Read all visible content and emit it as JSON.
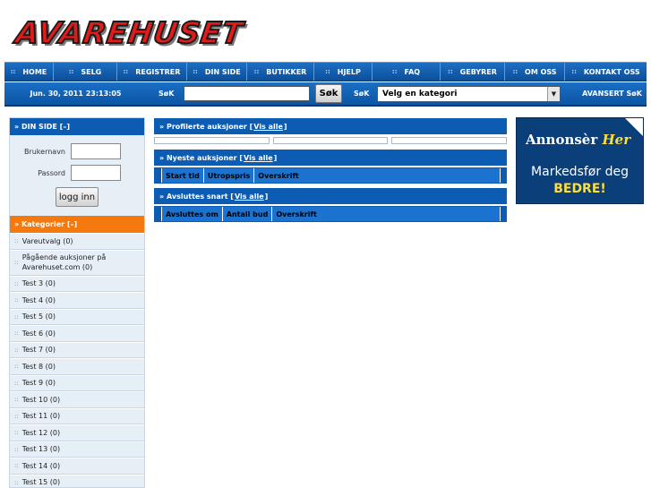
{
  "logo": {
    "text": "Avarehuset"
  },
  "nav": {
    "bullet": "::",
    "items": [
      "HOME",
      "SELG",
      "REGISTRER",
      "DIN SIDE",
      "BUTIKKER",
      "HJELP",
      "FAQ",
      "GEBYRER",
      "OM OSS",
      "KONTAKT OSS"
    ]
  },
  "subbar": {
    "date": "Jun. 30, 2011 23:13:05",
    "search_label": "SøK",
    "search_button": "Søk",
    "search_label2": "SøK",
    "category_select": "Velg en kategori",
    "advanced": "AVANSERT SøK"
  },
  "sidebar": {
    "din_side_header": "» DIN SIDE [–]",
    "username_label": "Brukernavn",
    "password_label": "Passord",
    "login_button": "logg inn",
    "categories_header": "» Kategorier [–]",
    "categories": [
      "Vareutvalg (0)",
      "Pågående auksjoner på Avarehuset.com (0)",
      "Test 3 (0)",
      "Test 4 (0)",
      "Test 5 (0)",
      "Test 6 (0)",
      "Test 7 (0)",
      "Test 8 (0)",
      "Test 9 (0)",
      "Test 10 (0)",
      "Test 11 (0)",
      "Test 12 (0)",
      "Test 13 (0)",
      "Test 14 (0)",
      "Test 15 (0)"
    ]
  },
  "panels": {
    "profilerte": {
      "title": "» Profilerte auksjoner [",
      "link": "Vis alle",
      "close": "]"
    },
    "nyeste": {
      "title": "» Nyeste auksjoner [",
      "link": "Vis alle",
      "close": "]",
      "columns": [
        "Start tid",
        "Utropspris",
        "Overskrift"
      ]
    },
    "avsluttes": {
      "title": "» Avsluttes snart [",
      "link": "Vis alle",
      "close": "]",
      "columns": [
        "Avsluttes om",
        "Antall bud",
        "Overskrift"
      ]
    }
  },
  "ad": {
    "line1": "Annonsèr",
    "line1_highlight": "Her",
    "line2": "Markedsfør deg",
    "line3": "BEDRE!"
  }
}
